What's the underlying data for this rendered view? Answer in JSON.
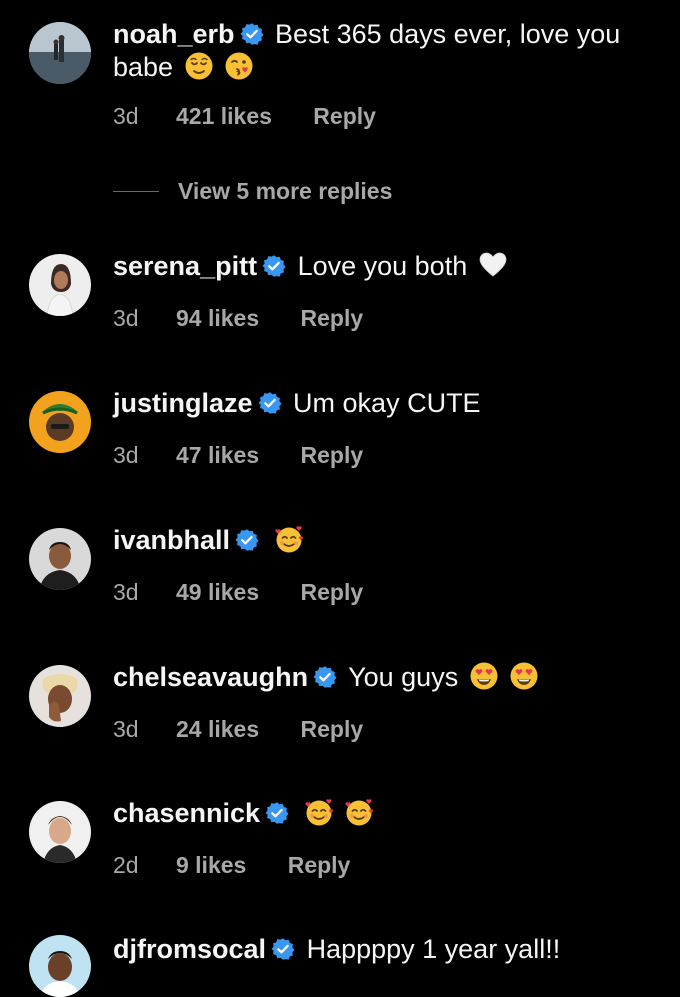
{
  "colors": {
    "background": "#000000",
    "text": "#f5f5f5",
    "secondary": "#a8a8a8",
    "verified_badge": "#3897f0"
  },
  "comments": [
    {
      "username": "noah_erb",
      "verified": true,
      "text": "Best 365 days ever, love you babe",
      "emojis": [
        "relieved-face-emoji",
        "face-blowing-kiss-emoji"
      ],
      "time": "3d",
      "likes": "421 likes",
      "reply": "Reply"
    },
    {
      "username": "serena_pitt",
      "verified": true,
      "text": "Love you both",
      "emojis": [
        "white-heart-emoji"
      ],
      "time": "3d",
      "likes": "94 likes",
      "reply": "Reply"
    },
    {
      "username": "justinglaze",
      "verified": true,
      "text": "Um okay CUTE",
      "emojis": [],
      "time": "3d",
      "likes": "47 likes",
      "reply": "Reply"
    },
    {
      "username": "ivanbhall",
      "verified": true,
      "text": "",
      "emojis": [
        "smiling-face-with-hearts-emoji"
      ],
      "time": "3d",
      "likes": "49 likes",
      "reply": "Reply"
    },
    {
      "username": "chelseavaughn",
      "verified": true,
      "text": "You guys",
      "emojis": [
        "heart-eyes-emoji",
        "heart-eyes-emoji"
      ],
      "time": "3d",
      "likes": "24 likes",
      "reply": "Reply"
    },
    {
      "username": "chasennick",
      "verified": true,
      "text": "",
      "emojis": [
        "smiling-face-with-hearts-emoji",
        "smiling-face-with-hearts-emoji"
      ],
      "time": "2d",
      "likes": "9 likes",
      "reply": "Reply"
    },
    {
      "username": "djfromsocal",
      "verified": true,
      "text": "Happppy 1 year yall!!",
      "emojis": [],
      "time": "",
      "likes": "",
      "reply": ""
    }
  ],
  "view_more_replies": "View 5 more replies"
}
